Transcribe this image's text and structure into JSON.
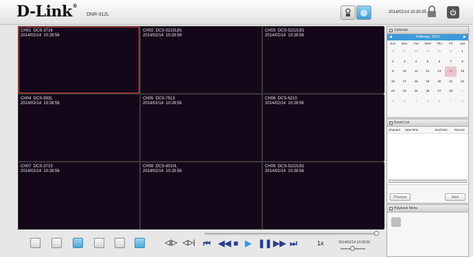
{
  "header": {
    "brand": "D-Link",
    "reg": "®",
    "model": "DNR-312L",
    "datetime": "2014/02/14 10:30:35"
  },
  "channels": [
    {
      "label": "CH01  DCS-3716",
      "time": "2014/02/14  10:28:56",
      "active": true
    },
    {
      "label": "CH02  DCS-5222LB1",
      "time": "2014/02/14  10:28:56"
    },
    {
      "label": "CH03  DCS-5222LB1",
      "time": "2014/02/14  10:28:56"
    },
    {
      "label": "CH04  DCS-933L",
      "time": "2014/02/14  10:28:56"
    },
    {
      "label": "CH05  DCS-7513",
      "time": "2014/02/14  10:28:56"
    },
    {
      "label": "CH06  DCS-6210",
      "time": "2014/02/14  10:28:56"
    },
    {
      "label": "CH07  DCS-3715",
      "time": "2014/02/14  10:28:56"
    },
    {
      "label": "CH08  DCS-6010L",
      "time": "2014/02/14  10:28:56"
    },
    {
      "label": "CH09  DCS-5222LB1",
      "time": "2014/02/14  10:28:56"
    }
  ],
  "playback": {
    "speed": "1x",
    "time": "2014/02/14  10:28:56",
    "layouts": [
      "single",
      "quad",
      "nine",
      "mixed-1",
      "mixed-2",
      "full"
    ],
    "selected_layout": "nine",
    "progress": 1.0
  },
  "calendar": {
    "title": "Calendar",
    "month": "February",
    "year": "2014",
    "days": [
      "Sun",
      "Mon",
      "Tue",
      "Wed",
      "Thu",
      "Fri",
      "Sat"
    ],
    "weeks": [
      [
        "26",
        "27",
        "28",
        "29",
        "30",
        "31",
        "1"
      ],
      [
        "2",
        "3",
        "4",
        "5",
        "6",
        "7",
        "8"
      ],
      [
        "9",
        "10",
        "11",
        "12",
        "13",
        "14",
        "15"
      ],
      [
        "16",
        "17",
        "18",
        "19",
        "20",
        "21",
        "22"
      ],
      [
        "23",
        "24",
        "25",
        "26",
        "27",
        "28",
        "1"
      ],
      [
        "2",
        "3",
        "4",
        "5",
        "6",
        "7",
        "8"
      ]
    ],
    "selected": "14"
  },
  "events": {
    "title": "Event List",
    "columns": [
      "Channel",
      "Start time",
      "End time",
      "Record"
    ],
    "previous": "Previous",
    "next": "Next"
  },
  "playback_menu": {
    "title": "Playback Menu"
  }
}
